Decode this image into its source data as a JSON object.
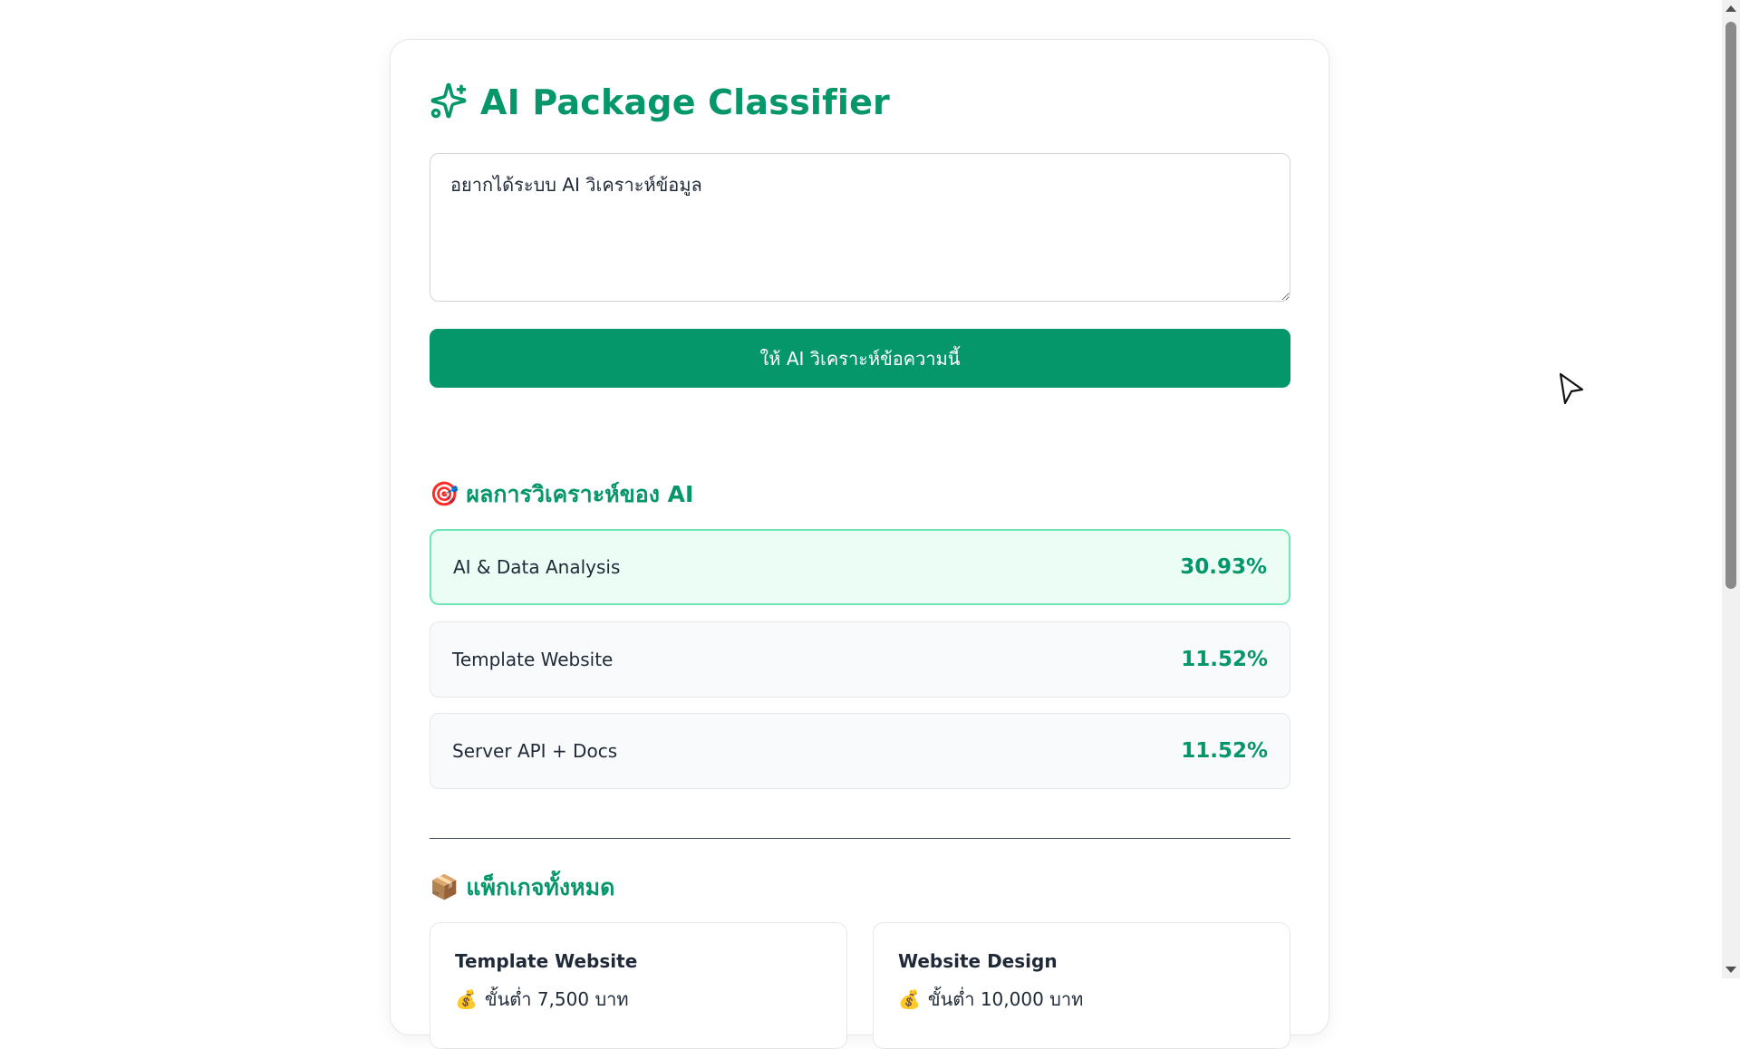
{
  "app": {
    "title": "AI Package Classifier",
    "accent_color": "#059669",
    "title_icon": "sparkles-icon"
  },
  "input": {
    "value": "อยากได้ระบบ AI วิเคราะห์ข้อมูล"
  },
  "analyze_button": {
    "label": "ให้ AI วิเคราะห์ข้อความนี้"
  },
  "results": {
    "heading_emoji": "🎯",
    "heading": "ผลการวิเคราะห์ของ AI",
    "items": [
      {
        "name": "AI & Data Analysis",
        "percent": "30.93%"
      },
      {
        "name": "Template Website",
        "percent": "11.52%"
      },
      {
        "name": "Server API + Docs",
        "percent": "11.52%"
      }
    ]
  },
  "packages": {
    "heading_emoji": "📦",
    "heading": "แพ็กเกจทั้งหมด",
    "items": [
      {
        "name": "Template Website",
        "price_emoji": "💰",
        "price": "ขั้นต่ำ 7,500 บาท"
      },
      {
        "name": "Website Design",
        "price_emoji": "💰",
        "price": "ขั้นต่ำ 10,000 บาท"
      }
    ]
  }
}
